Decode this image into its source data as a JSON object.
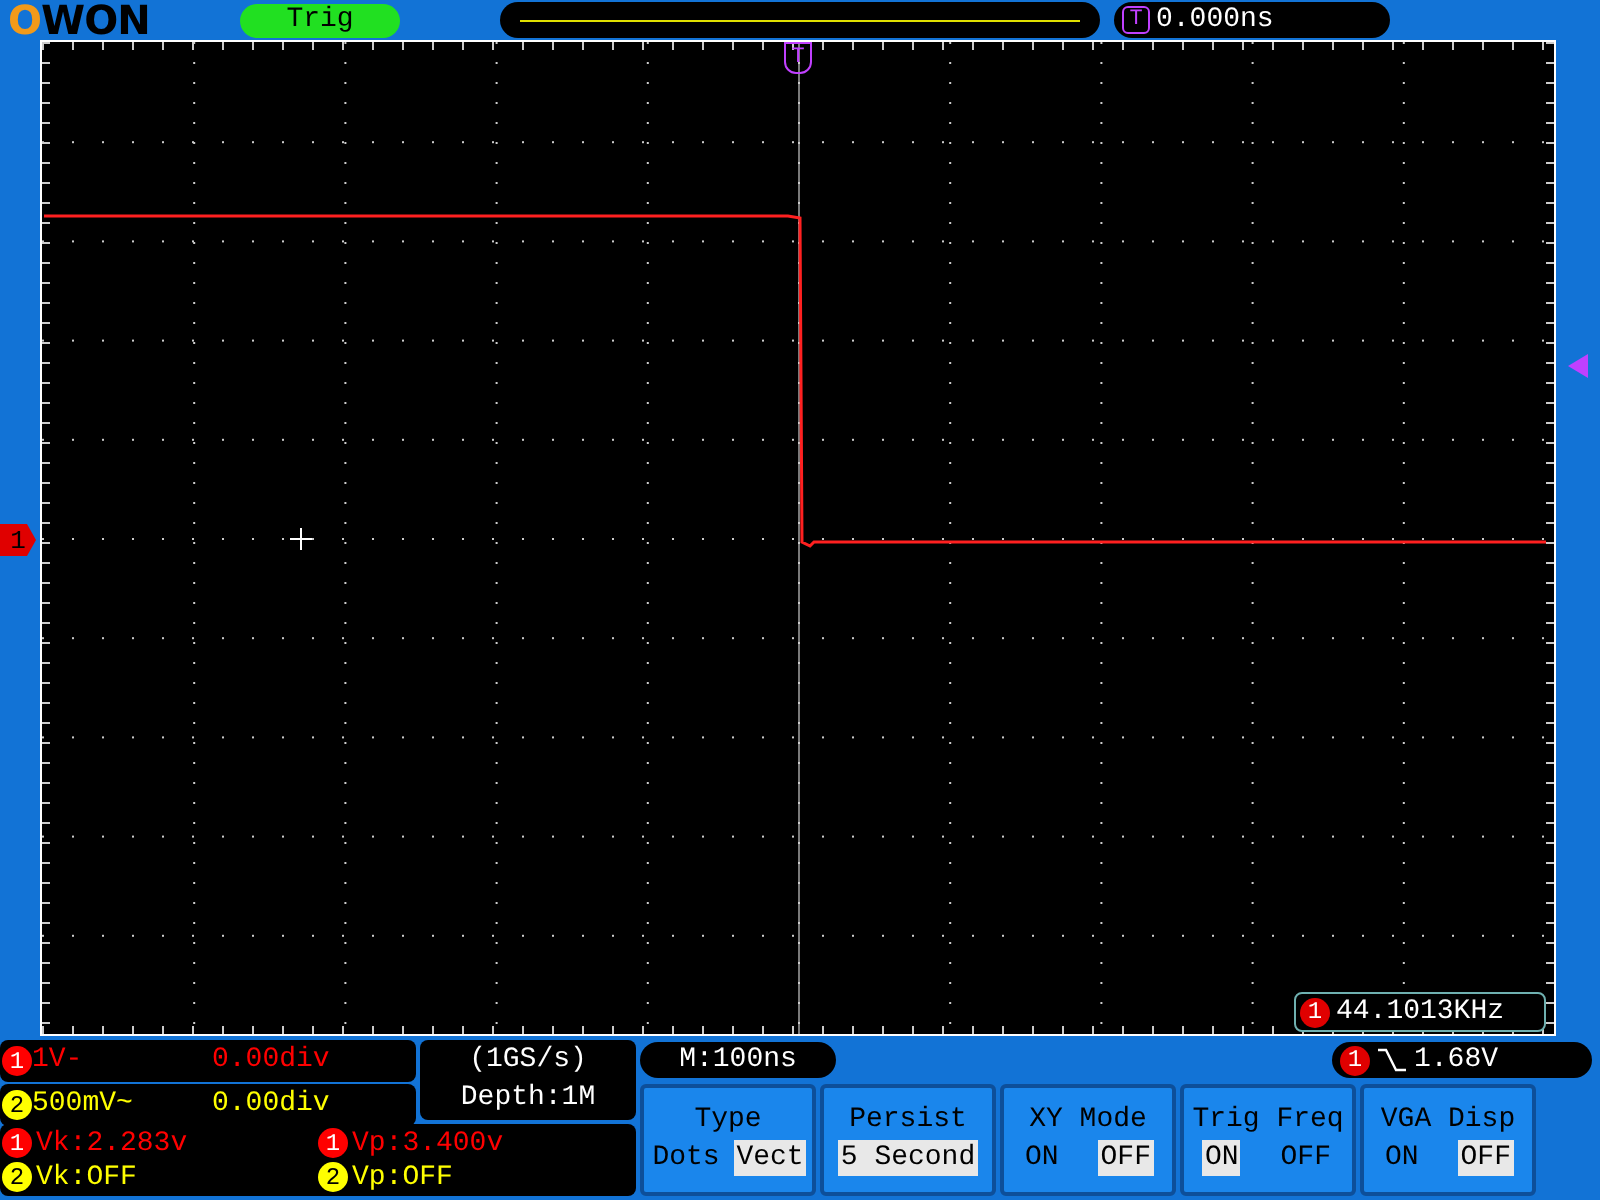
{
  "logo": "OWON",
  "trigger_status": "Trig",
  "trigger_position_marker": "T",
  "time_offset": {
    "badge": "T",
    "value": "0.000ns"
  },
  "channel_marker": "1",
  "frequency": {
    "badge": "1",
    "value": "44.1013KHz"
  },
  "channels": [
    {
      "badge": "1",
      "scale": "1V-",
      "offset": "0.00div",
      "color": "#ff0000"
    },
    {
      "badge": "2",
      "scale": "500mV~",
      "offset": "0.00div",
      "color": "#ffff00"
    }
  ],
  "acquisition": {
    "sample_rate": "(1GS/s)",
    "depth": "Depth:1M"
  },
  "measurements": [
    {
      "badge": "1",
      "text": "Vk:2.283v",
      "color": "#ff0000"
    },
    {
      "badge": "1",
      "text": "Vp:3.400v",
      "color": "#ff0000"
    },
    {
      "badge": "2",
      "text": "Vk:OFF",
      "color": "#ffff00"
    },
    {
      "badge": "2",
      "text": "Vp:OFF",
      "color": "#ffff00"
    }
  ],
  "timebase": "M:100ns",
  "trigger": {
    "badge": "1",
    "reading": "1.68V"
  },
  "menu": [
    {
      "title": "Type",
      "options": [
        {
          "label": "Dots",
          "selected": false
        },
        {
          "label": "Vect",
          "selected": true
        }
      ]
    },
    {
      "title": "Persist",
      "options": [
        {
          "label": "5 Second",
          "selected": true
        }
      ]
    },
    {
      "title": "XY Mode",
      "options": [
        {
          "label": "ON",
          "selected": false
        },
        {
          "label": "OFF",
          "selected": true
        }
      ]
    },
    {
      "title": "Trig Freq",
      "options": [
        {
          "label": "ON",
          "selected": true
        },
        {
          "label": "OFF",
          "selected": false
        }
      ]
    },
    {
      "title": "VGA Disp",
      "options": [
        {
          "label": "ON",
          "selected": false
        },
        {
          "label": "OFF",
          "selected": true
        }
      ]
    }
  ]
}
